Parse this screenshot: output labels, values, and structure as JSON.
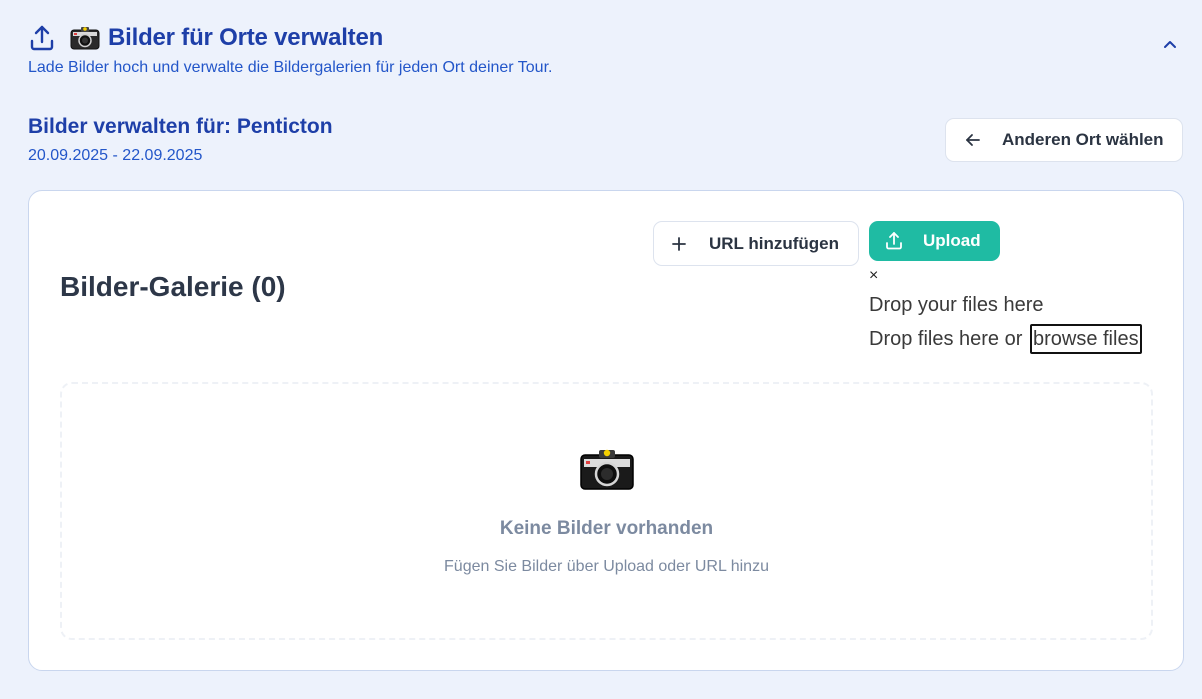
{
  "section": {
    "title": "Bilder für Orte verwalten",
    "subtitle": "Lade Bilder hoch und verwalte die Bildergalerien für jeden Ort deiner Tour.",
    "icons": [
      "upload-icon",
      "camera-emoji",
      "chevron-up-icon"
    ]
  },
  "location": {
    "title": "Bilder verwalten für: Penticton",
    "dates": "20.09.2025 - 22.09.2025",
    "change_button": "Anderen Ort wählen"
  },
  "gallery": {
    "title": "Bilder-Galerie (0)",
    "add_url_button": "URL hinzufügen",
    "upload_button": "Upload",
    "dropzone": {
      "close": "×",
      "drop_here": "Drop your files here",
      "drop_or": "Drop files here or",
      "browse": "browse files"
    },
    "empty": {
      "title": "Keine Bilder vorhanden",
      "subtitle": "Fügen Sie Bilder über Upload oder URL hinzu"
    }
  },
  "colors": {
    "background": "#edf2fc",
    "heading_blue": "#1e3fa8",
    "text_blue": "#2356c9",
    "upload_green": "#1fbba3",
    "muted_gray": "#7c8aa0"
  }
}
